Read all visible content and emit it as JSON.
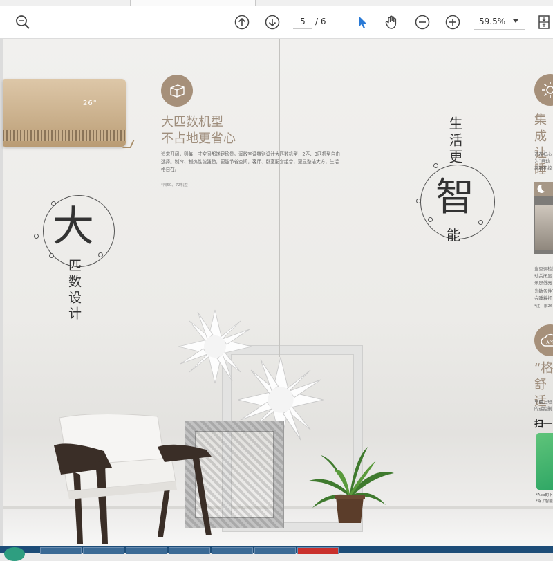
{
  "toolbar": {
    "current_page": "5",
    "total_pages": "/ 6",
    "zoom": "59.5%",
    "icons": [
      "zoom-search-icon",
      "page-up-icon",
      "page-down-icon",
      "select-arrow-icon",
      "hand-pan-icon",
      "zoom-out-icon",
      "zoom-in-icon",
      "fit-page-icon"
    ],
    "accent": "#2a7ad6"
  },
  "document": {
    "ac_display": "26°",
    "feature1": {
      "title_line1": "大匹数机型",
      "title_line2": "不占地更省心",
      "body": "追求开阔，则每一寸空间都饶足珍贵。润敞空调特别设计大匹数机型，2匹、3匹机型自由选择。制冷、制热性能强劲，更能节省空间，客厅、卧室配套组合，更显整洁大方，生活格自在。",
      "note": "*限50、72机型"
    },
    "calligraphy_left": {
      "big_char": "大",
      "vertical_text": "匹数设计"
    },
    "calligraphy_right": {
      "vertical_text_top": "生活更",
      "big_char": "智",
      "bottom_char": "能"
    },
    "right_column": {
      "title1_line1": "集成",
      "title1_line2": "让睡",
      "text_a": "还在担心\n为“自动\n夹腹和控",
      "text_b": "当空调检测\n动关闭显\n示屏低亮",
      "text_c": "光敏条件下\n会睡着打",
      "note_c": "*注：限26",
      "title2_line1": "“格",
      "title2_line2": "舒适",
      "text_d": "早晨上班\n的遥控删",
      "scan": "扫一",
      "foot": "*App的下\n*除了智能"
    },
    "colors": {
      "accent_brown": "#a6907a",
      "title_brown": "#9f8e7d"
    }
  }
}
